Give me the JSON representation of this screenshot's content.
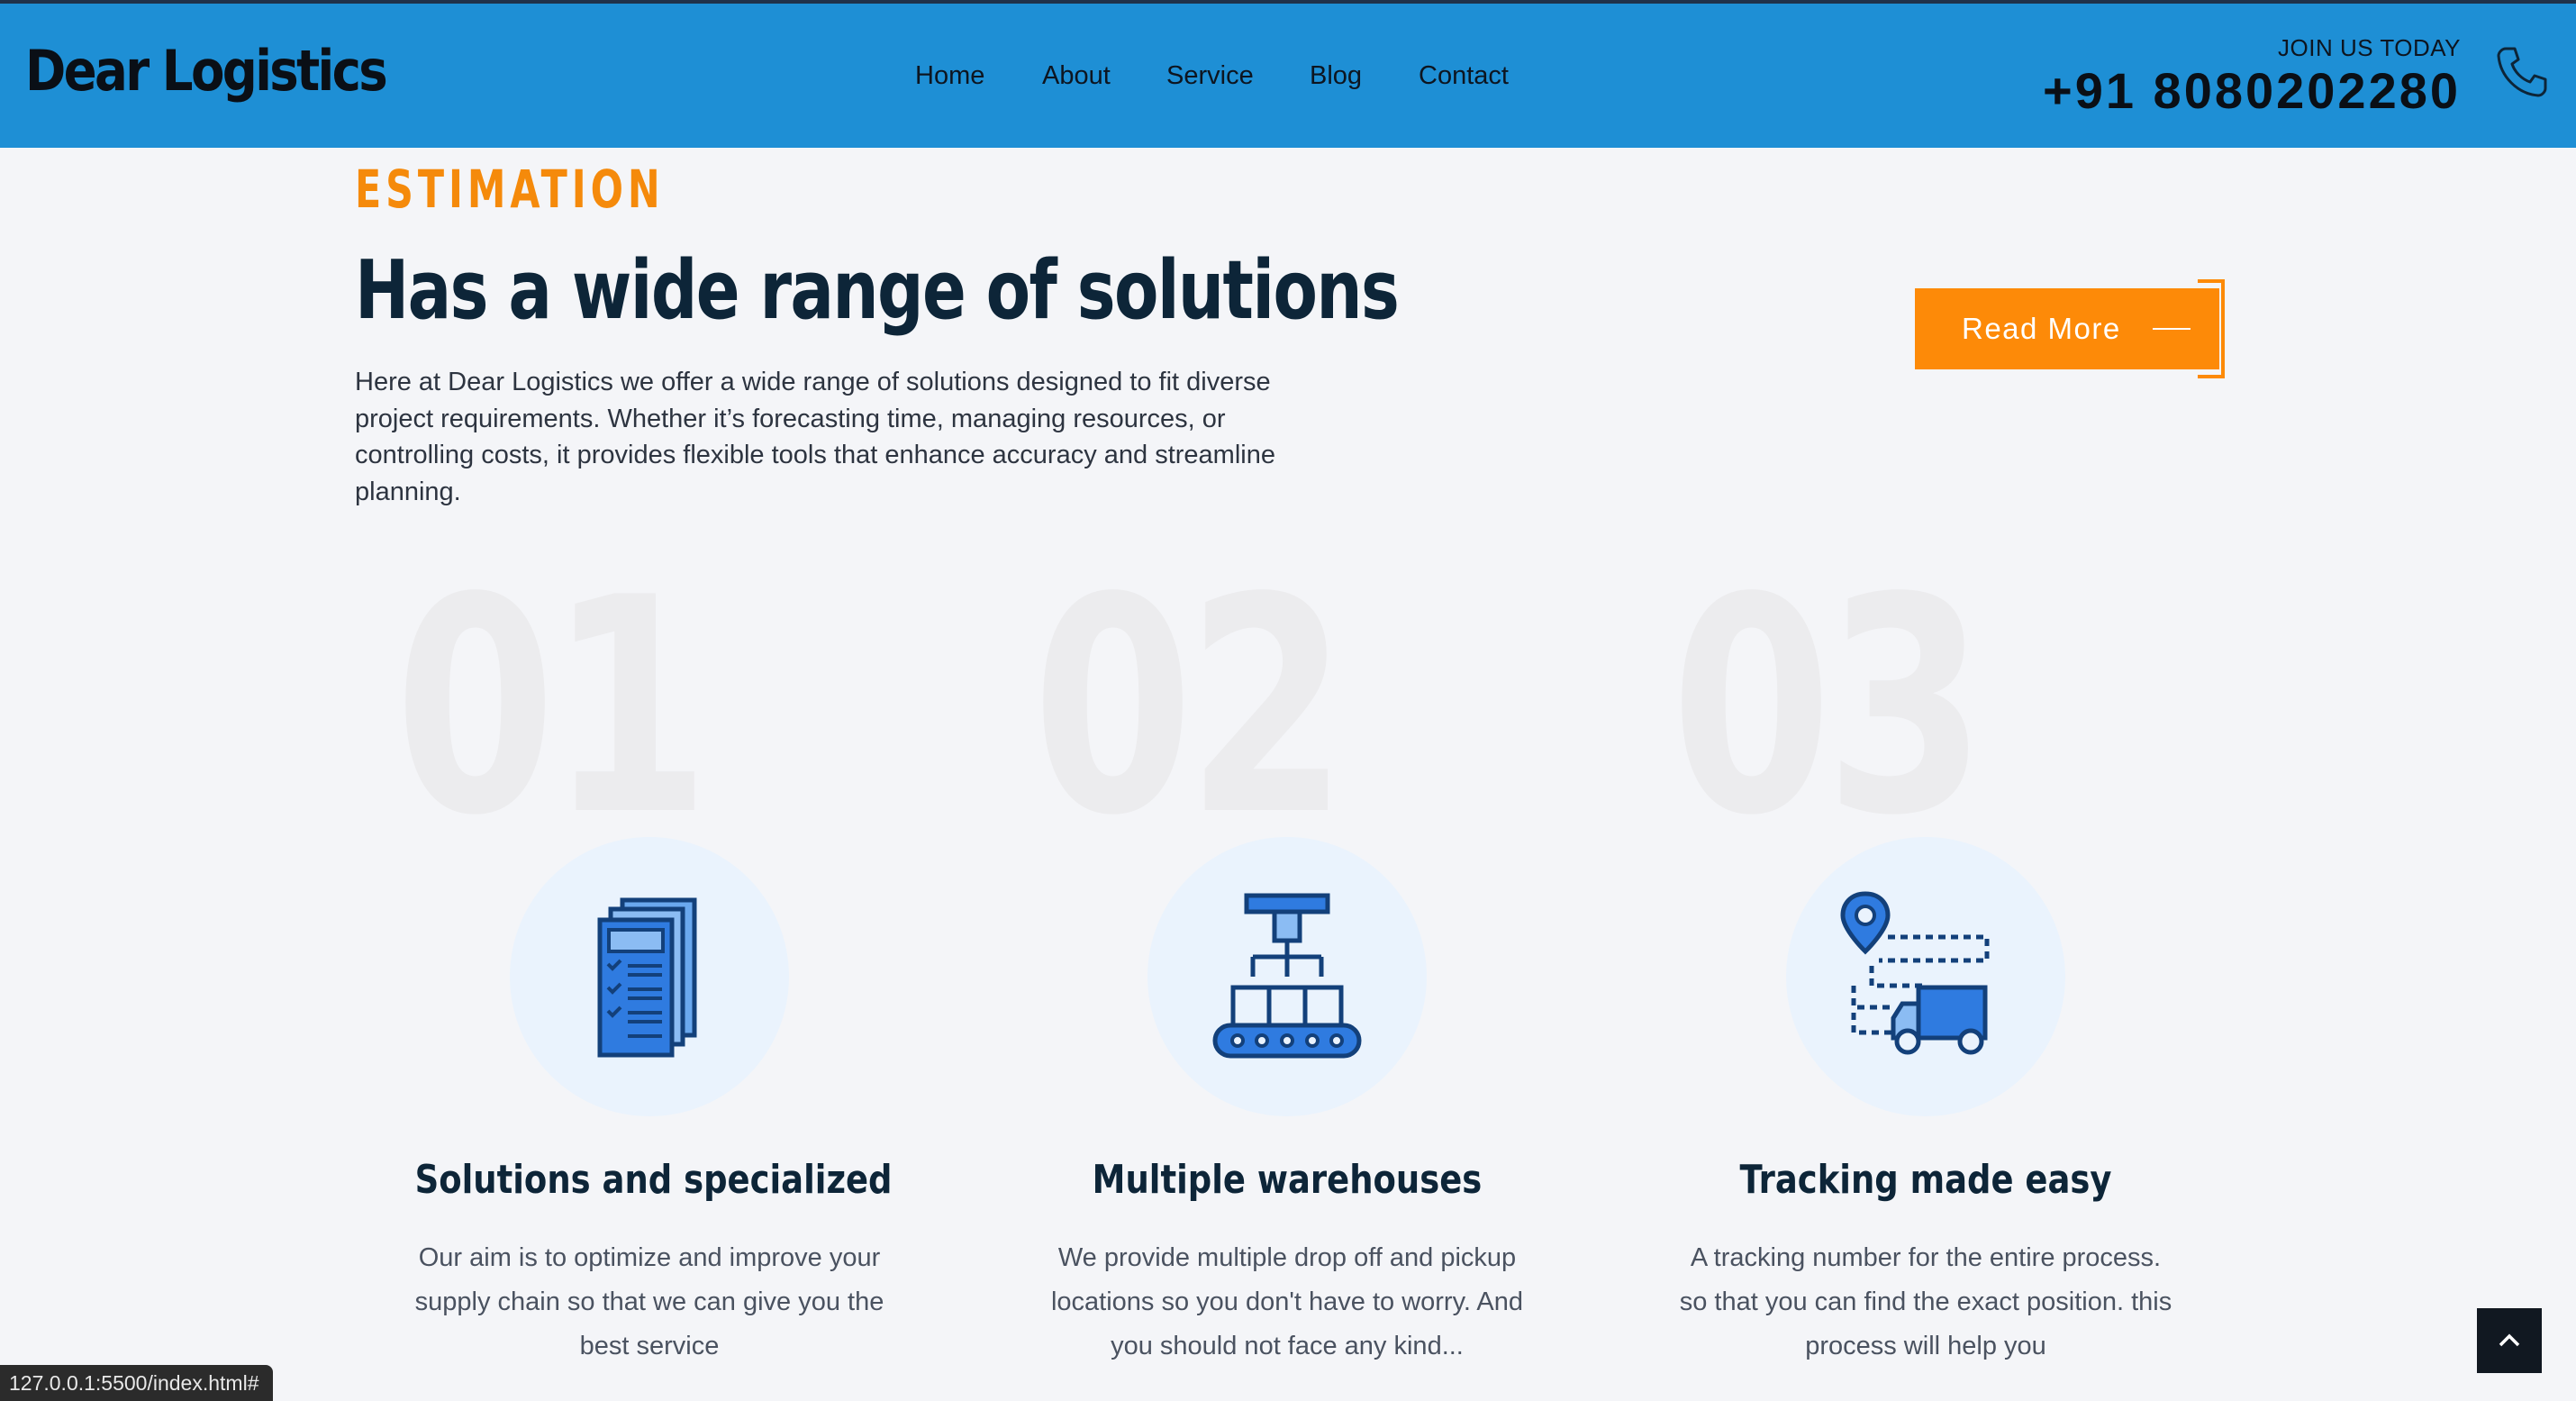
{
  "brand": {
    "logo": "Dear Logistics"
  },
  "nav": {
    "items": [
      "Home",
      "About",
      "Service",
      "Blog",
      "Contact"
    ]
  },
  "header": {
    "join_label": "JOIN US TODAY",
    "phone": "+91 8080202280"
  },
  "estimation": {
    "eyebrow": "ESTIMATION",
    "headline": "Has a wide range of solutions",
    "intro": "Here at Dear Logistics we offer a wide range of solutions designed to fit diverse project requirements. Whether it’s forecasting time, managing resources, or controlling costs, it provides flexible tools that enhance accuracy and streamline planning.",
    "read_more": "Read More"
  },
  "features": [
    {
      "number": "01",
      "icon": "documents-icon",
      "title": "Solutions and specialized",
      "text": "Our aim is to optimize and improve your supply chain so that we can give you the best service"
    },
    {
      "number": "02",
      "icon": "conveyor-icon",
      "title": "Multiple warehouses",
      "text": "We provide multiple drop off and pickup locations so you don't have to worry. And you should not face any kind..."
    },
    {
      "number": "03",
      "icon": "delivery-truck-icon",
      "title": "Tracking made easy",
      "text": "A tracking number for the entire process. so that you can find the exact position. this process will help you"
    }
  ],
  "status_bar": {
    "url": "127.0.0.1:5500/index.html#"
  },
  "colors": {
    "header_bg": "#1e8fd5",
    "accent": "#fd8a08",
    "heading": "#0d2538",
    "icon_blue": "#1e6fd9"
  }
}
